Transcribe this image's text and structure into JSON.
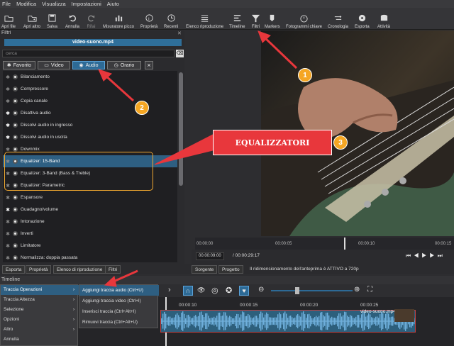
{
  "menu": [
    "File",
    "Modifica",
    "Visualizza",
    "Impostazioni",
    "Aiuto"
  ],
  "toolbar": [
    {
      "label": "Apri file",
      "icon": "folder-open-icon"
    },
    {
      "label": "Apri altro",
      "icon": "folder-more-icon"
    },
    {
      "label": "Salva",
      "icon": "save-icon"
    },
    {
      "label": "Annulla",
      "icon": "undo-icon"
    },
    {
      "label": "Rifai",
      "icon": "redo-icon"
    },
    {
      "label": "Misuratore picco",
      "icon": "peak-meter-icon"
    },
    {
      "label": "Proprietà",
      "icon": "properties-icon"
    },
    {
      "label": "Recenti",
      "icon": "recent-icon"
    },
    {
      "label": "Elenco riproduzione",
      "icon": "playlist-icon"
    },
    {
      "label": "Timeline",
      "icon": "timeline-icon"
    },
    {
      "label": "Filtri",
      "icon": "filter-icon"
    },
    {
      "label": "Markers",
      "icon": "marker-icon"
    },
    {
      "label": "Fotogrammi chiave",
      "icon": "keyframes-icon"
    },
    {
      "label": "Cronologia",
      "icon": "history-icon"
    },
    {
      "label": "Esporta",
      "icon": "export-icon"
    },
    {
      "label": "Attività",
      "icon": "jobs-icon"
    }
  ],
  "filters": {
    "title": "Filtri",
    "clip": "video-suono.mp4",
    "search_placeholder": "cerca",
    "tabs": [
      "Favorito",
      "Video",
      "Audio",
      "Orario"
    ],
    "active_tab": "Audio",
    "items": [
      {
        "label": "Bilanciamento",
        "fav": false
      },
      {
        "label": "Compressore",
        "fav": false
      },
      {
        "label": "Copia canale",
        "fav": false
      },
      {
        "label": "Disattiva audio",
        "fav": true
      },
      {
        "label": "Dissolvi audio in ingresso",
        "fav": true
      },
      {
        "label": "Dissolvi audio in uscita",
        "fav": true
      },
      {
        "label": "Downmix",
        "fav": false
      },
      {
        "label": "Equalizer: 15-Band",
        "fav": false,
        "selected": true
      },
      {
        "label": "Equalizer: 3-Band (Bass & Treble)",
        "fav": false
      },
      {
        "label": "Equalizer: Parametric",
        "fav": false
      },
      {
        "label": "Espansore",
        "fav": false
      },
      {
        "label": "Guadagno/volume",
        "fav": true
      },
      {
        "label": "Intonazione",
        "fav": false
      },
      {
        "label": "Inverti",
        "fav": false
      },
      {
        "label": "Limitatore",
        "fav": false
      },
      {
        "label": "Normalizza: doppia passata",
        "fav": false
      }
    ]
  },
  "ruler": [
    "00:00:00",
    "00:00:05",
    "00:00:10",
    "00:00:15"
  ],
  "timecode": "00:00:09:00",
  "duration": "/ 00:00:29:17",
  "bottom_tabs": [
    "Esporta",
    "Proprietà",
    "Elenco di riproduzione",
    "Filtri"
  ],
  "source_tabs": [
    "Sorgente",
    "Progetto"
  ],
  "status": "Il ridimensionamento dell'anteprima è ATTIVO a 720p",
  "timeline": {
    "title": "Timeline",
    "ruler": [
      "00:00:10",
      "00:00:15",
      "00:00:20",
      "00:00:25"
    ],
    "clip": "video-suono.mp4",
    "menu1": [
      {
        "label": "Traccia Operazioni",
        "sub": true,
        "selected": true
      },
      {
        "label": "Traccia Altezza",
        "sub": true
      },
      {
        "label": "Selezione",
        "sub": true
      },
      {
        "label": "Opzioni",
        "sub": true
      },
      {
        "label": "Altro",
        "sub": true
      },
      {
        "label": "Annulla",
        "sub": false
      }
    ],
    "menu2": [
      {
        "label": "Aggiungi traccia audio (Ctrl+U)",
        "selected": true
      },
      {
        "label": "Aggiungi traccia video (Ctrl+I)"
      },
      {
        "label": "Inserisci traccia (Ctrl+Alt+I)"
      },
      {
        "label": "Rimuovi traccia (Ctrl+Alt+U)"
      }
    ]
  },
  "annotations": {
    "callout": "EQUALIZZATORI",
    "badges": [
      "1",
      "2",
      "3"
    ],
    "accent": "#e8373c",
    "badge_color": "#f5a623"
  }
}
